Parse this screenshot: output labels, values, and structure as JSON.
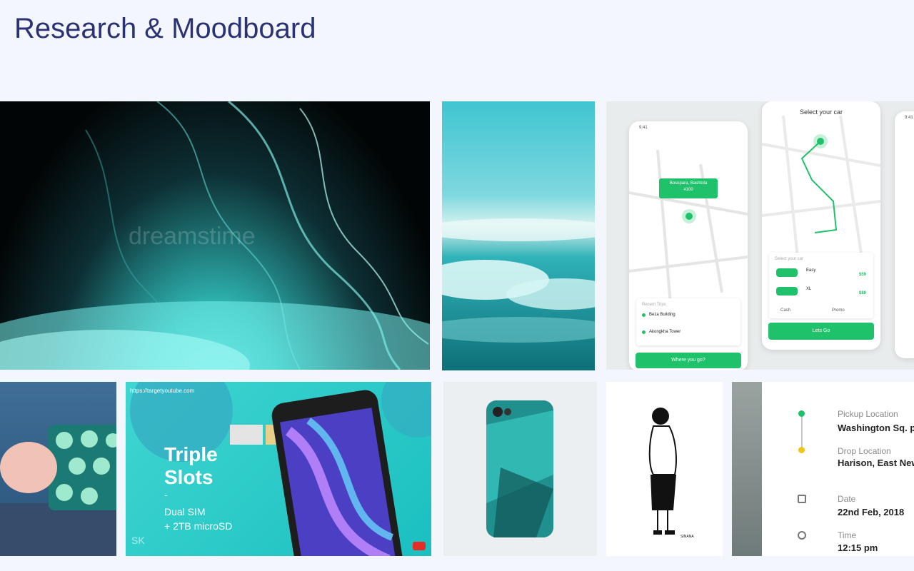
{
  "page": {
    "title": "Research & Moodboard"
  },
  "tiles": {
    "smoke": {
      "watermark": "dreamstime"
    },
    "app": {
      "status_time": "9:41",
      "select_car_title": "Select your car",
      "pin_label_1": "Bosupara, Bashtola",
      "pin_label_2": "4100",
      "recent_trips_label": "Recent Trips",
      "trip_1": "Beza Building",
      "trip_2": "Akongkha Tower",
      "where_button": "Where you go?",
      "select_your_car_label": "Select your car",
      "car_1_name": "Easy",
      "car_1_price": "$59",
      "car_2_name": "XL",
      "car_2_price": "$80",
      "payment_label": "Cash",
      "promo_label": "Promo",
      "lets_go_button": "Lets Go"
    },
    "phone_promo": {
      "url": "https://targetyoutube.com",
      "title_line1": "Triple",
      "title_line2": "Slots",
      "dash": "-",
      "sub_line1": "Dual SIM",
      "sub_line2": "+ 2TB microSD",
      "logo": "SK"
    },
    "sketch": {
      "signature": "SINANA"
    },
    "trip": {
      "pickup_label": "Pickup Location",
      "pickup_value": "Washington Sq. p",
      "drop_label": "Drop Location",
      "drop_value": "Harison, East New",
      "date_label": "Date",
      "date_value": "22nd Feb, 2018",
      "time_label": "Time",
      "time_value": "12:15 pm"
    }
  },
  "colors": {
    "title": "#2b3274",
    "background": "#f3f6fd",
    "accent_green": "#1fc16a",
    "teal": "#2fc2c4"
  }
}
